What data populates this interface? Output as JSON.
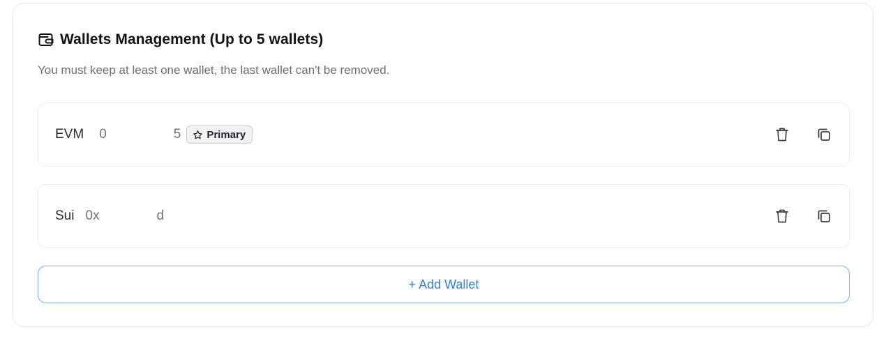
{
  "header": {
    "icon": "wallet-icon",
    "title": "Wallets Management (Up to 5 wallets)",
    "subtitle": "You must keep at least one wallet, the last wallet can't be removed."
  },
  "wallets": [
    {
      "chain": "EVM",
      "address_start": "0",
      "address_end": "5",
      "badge": {
        "icon": "star-icon",
        "label": "Primary"
      },
      "actions": [
        "trash-icon",
        "copy-icon"
      ]
    },
    {
      "chain": "Sui",
      "address_start": "0x",
      "address_end": "d",
      "actions": [
        "trash-icon",
        "copy-icon"
      ]
    }
  ],
  "add_button": {
    "label": "+ Add Wallet",
    "color": "#2f7fe0"
  }
}
